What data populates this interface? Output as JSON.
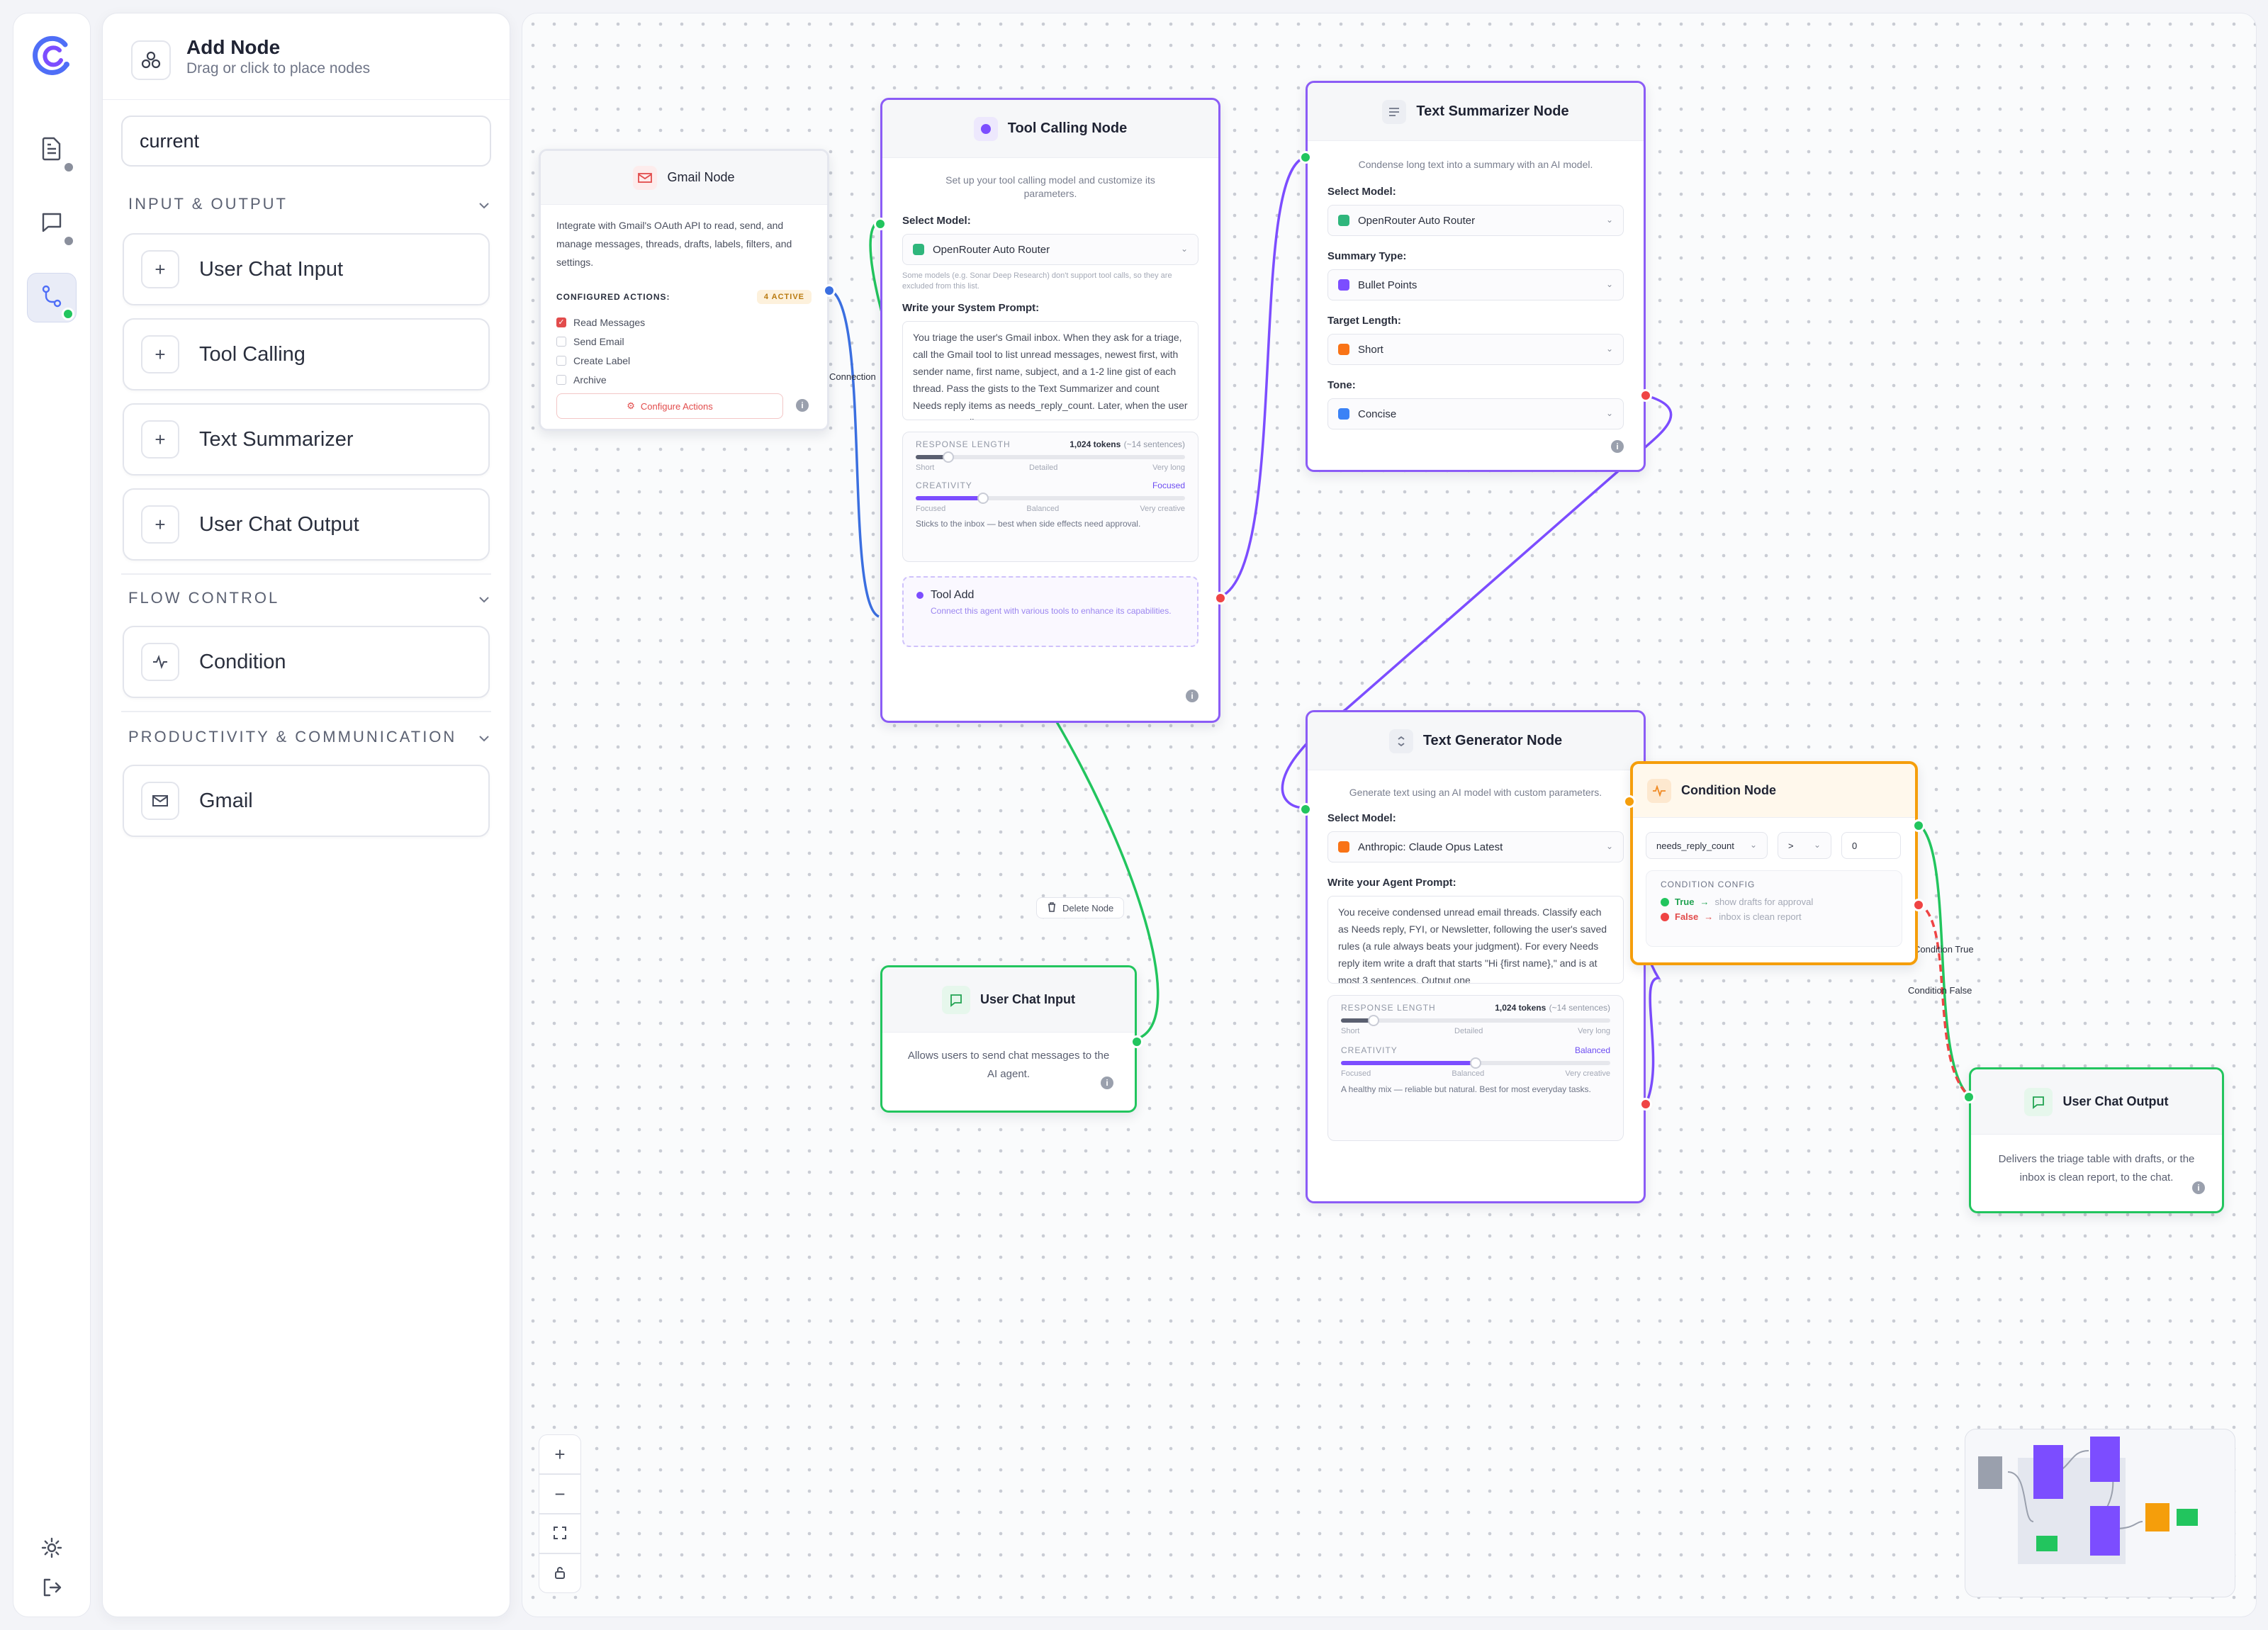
{
  "panel": {
    "title": "Add Node",
    "subtitle": "Drag or click to place nodes",
    "search_value": "current",
    "sections": [
      {
        "label": "INPUT & OUTPUT",
        "items": [
          "User Chat Input",
          "Tool Calling",
          "Text Summarizer",
          "User Chat Output"
        ]
      },
      {
        "label": "FLOW CONTROL",
        "items": [
          "Condition"
        ]
      },
      {
        "label": "PRODUCTIVITY & COMMUNICATION",
        "items": [
          "Gmail"
        ]
      }
    ]
  },
  "gmail": {
    "title": "Gmail Node",
    "desc": "Integrate with Gmail's OAuth API to read, send, and manage messages, threads, drafts, labels, filters, and settings.",
    "configured_label": "CONFIGURED ACTIONS:",
    "active_badge": "4 ACTIVE",
    "actions": [
      {
        "label": "Read Messages",
        "checked": true
      },
      {
        "label": "Send Email",
        "checked": false
      },
      {
        "label": "Create Label",
        "checked": false
      },
      {
        "label": "Archive",
        "checked": false
      }
    ],
    "configure_button": "Configure Actions"
  },
  "tool_calling": {
    "title": "Tool Calling Node",
    "desc": "Set up your tool calling model and customize its parameters.",
    "select_model_label": "Select Model:",
    "model": "OpenRouter Auto Router",
    "note": "Some models (e.g. Sonar Deep Research) don't support tool calls, so they are excluded from this list.",
    "prompt_label": "Write your System Prompt:",
    "prompt": "You triage the user's Gmail inbox. When they ask for a triage, call the Gmail tool to list unread messages, newest first, with sender name, first name, subject, and a 1-2 line gist of each thread. Pass the gists to the Text Summarizer and count Needs reply items as needs_reply_count. Later, when the user approves, call",
    "response_length_label": "RESPONSE LENGTH",
    "response_length_value": "1,024 tokens",
    "response_length_hint": "(~14 sentences)",
    "response_length_fraction": 0.12,
    "length_ticks": [
      "Short",
      "Detailed",
      "Very long"
    ],
    "creativity_label": "CREATIVITY",
    "creativity_value": "Focused",
    "creativity_fraction": 0.25,
    "creativity_ticks": [
      "Focused",
      "Balanced",
      "Very creative"
    ],
    "creativity_hint": "Sticks to the inbox — best when side effects need approval.",
    "tool_add_title": "Tool Add",
    "tool_add_desc": "Connect this agent with various tools to enhance its capabilities."
  },
  "summarizer": {
    "title": "Text Summarizer Node",
    "desc": "Condense long text into a summary with an AI model.",
    "select_model_label": "Select Model:",
    "model": "OpenRouter Auto Router",
    "summary_type_label": "Summary Type:",
    "summary_type": "Bullet Points",
    "target_length_label": "Target Length:",
    "target_length": "Short",
    "tone_label": "Tone:",
    "tone": "Concise"
  },
  "generator": {
    "title": "Text Generator Node",
    "desc": "Generate text using an AI model with custom parameters.",
    "select_model_label": "Select Model:",
    "model": "Anthropic: Claude Opus Latest",
    "prompt_label": "Write your Agent Prompt:",
    "prompt": "You receive condensed unread email threads. Classify each as Needs reply, FYI, or Newsletter, following the user's saved rules (a rule always beats your judgment). For every Needs reply item write a draft that starts \"Hi {first name},\" and is at most 3 sentences. Output one",
    "response_length_label": "RESPONSE LENGTH",
    "response_length_value": "1,024 tokens",
    "response_length_hint": "(~14 sentences)",
    "response_length_fraction": 0.12,
    "length_ticks": [
      "Short",
      "Detailed",
      "Very long"
    ],
    "creativity_label": "CREATIVITY",
    "creativity_value": "Balanced",
    "creativity_fraction": 0.5,
    "creativity_ticks": [
      "Focused",
      "Balanced",
      "Very creative"
    ],
    "creativity_hint": "A healthy mix — reliable but natural. Best for most everyday tasks."
  },
  "condition": {
    "title": "Condition Node",
    "field": "needs_reply_count",
    "operator": ">",
    "value": "0",
    "config_label": "CONDITION CONFIG",
    "true_label": "True",
    "true_desc": "show drafts for approval",
    "false_label": "False",
    "false_desc": "inbox is clean report"
  },
  "chat_input": {
    "title": "User Chat Input",
    "desc": "Allows users to send chat messages to the AI agent."
  },
  "chat_output": {
    "title": "User Chat Output",
    "desc": "Delivers the triage table with drafts, or the inbox is clean report, to the chat."
  },
  "edge_labels": {
    "connection": "Connection",
    "condition_true": "Condition True",
    "condition_false": "Condition False",
    "delete_node": "Delete Node"
  },
  "colors": {
    "purple": "#7c4dff",
    "green": "#22c55e",
    "blue": "#3b6fe0",
    "orange": "#f59e0b",
    "red": "#ef4444"
  }
}
